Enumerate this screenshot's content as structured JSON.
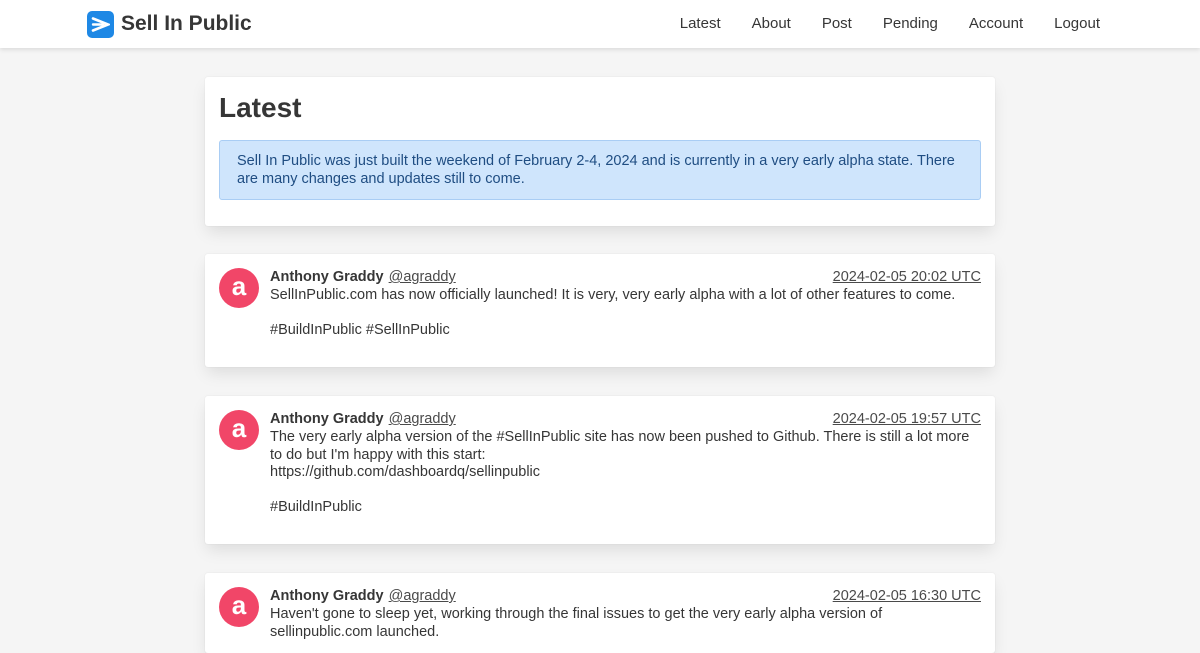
{
  "brand": {
    "name": "Sell In Public",
    "logo_icon": "send-arrow-icon",
    "logo_color": "#1e88e5"
  },
  "nav": {
    "items": [
      {
        "label": "Latest"
      },
      {
        "label": "About"
      },
      {
        "label": "Post"
      },
      {
        "label": "Pending"
      },
      {
        "label": "Account"
      },
      {
        "label": "Logout"
      }
    ]
  },
  "main": {
    "title": "Latest",
    "notice": "Sell In Public was just built the weekend of February 2-4, 2024 and is currently in a very early alpha state. There are many changes and updates still to come."
  },
  "colors": {
    "avatar": "#f14668",
    "notice_bg": "#cfe5fc",
    "background": "#f5f5f5"
  },
  "posts": [
    {
      "avatar_letter": "a",
      "author": "Anthony Graddy",
      "handle": "@agraddy",
      "timestamp": "2024-02-05 20:02 UTC",
      "text": "SellInPublic.com has now officially launched! It is very, very early alpha with a lot of other features to come.\n\n#BuildInPublic #SellInPublic"
    },
    {
      "avatar_letter": "a",
      "author": "Anthony Graddy",
      "handle": "@agraddy",
      "timestamp": "2024-02-05 19:57 UTC",
      "text": "The very early alpha version of the #SellInPublic site has now been pushed to Github. There is still a lot more to do but I'm happy with this start:\nhttps://github.com/dashboardq/sellinpublic\n\n#BuildInPublic"
    },
    {
      "avatar_letter": "a",
      "author": "Anthony Graddy",
      "handle": "@agraddy",
      "timestamp": "2024-02-05 16:30 UTC",
      "text": "Haven't gone to sleep yet, working through the final issues to get the very early alpha version of sellinpublic.com launched."
    }
  ]
}
